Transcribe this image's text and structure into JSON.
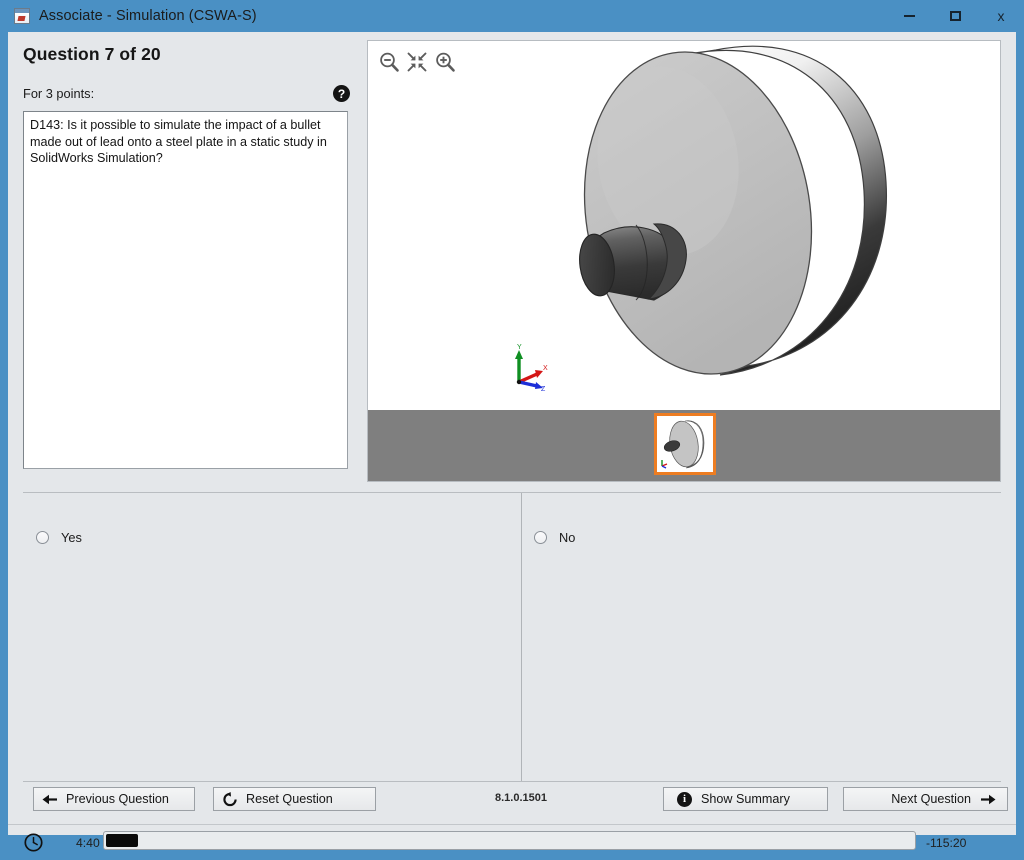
{
  "window": {
    "title": "Associate - Simulation (CSWA-S)",
    "icon": "app-icon",
    "controls": {
      "minimize": "minimize-icon",
      "maximize": "maximize-icon",
      "close": "x"
    },
    "accent_color": "#4a90c4",
    "client_bg": "#e4e7ea"
  },
  "question": {
    "heading": "Question 7 of 20",
    "points_label": "For 3 points:",
    "help_glyph": "?",
    "text": "D143: Is it possible to simulate the impact of a bullet made out of lead onto a steel plate in a static study in SolidWorks Simulation?",
    "current_number": 7,
    "total": 20,
    "points": 3
  },
  "viewport": {
    "toolbar": [
      {
        "name": "zoom-out-icon",
        "label": "Zoom Out"
      },
      {
        "name": "zoom-to-fit-icon",
        "label": "Zoom to Fit"
      },
      {
        "name": "zoom-in-icon",
        "label": "Zoom In"
      }
    ],
    "triad": {
      "y_label": "Y",
      "x_label": "X",
      "z_label": "Z",
      "y_color": "#0f8f22",
      "x_color": "#d41616",
      "z_color": "#1d2fd8"
    },
    "model_colors": {
      "plate_face": "#c0c0c0",
      "plate_rim_light": "#fdfdfd",
      "plate_rim_dark": "#2b2b2b",
      "bullet": "#3c3c3c",
      "outline": "#4a4a4a"
    },
    "thumbnail_strip_color": "#7f7f7f",
    "thumbnail_selected_color": "#ed7d22"
  },
  "answers": {
    "options": [
      {
        "label": "Yes",
        "selected": false
      },
      {
        "label": "No",
        "selected": false
      }
    ]
  },
  "navigation": {
    "previous_label": "Previous Question",
    "reset_label": "Reset Question",
    "summary_label": "Show Summary",
    "next_label": "Next Question",
    "version": "8.1.0.1501"
  },
  "status": {
    "clock_icon": "clock-icon",
    "elapsed": "4:40",
    "remaining": "-115:20",
    "progress_percent": 4
  }
}
